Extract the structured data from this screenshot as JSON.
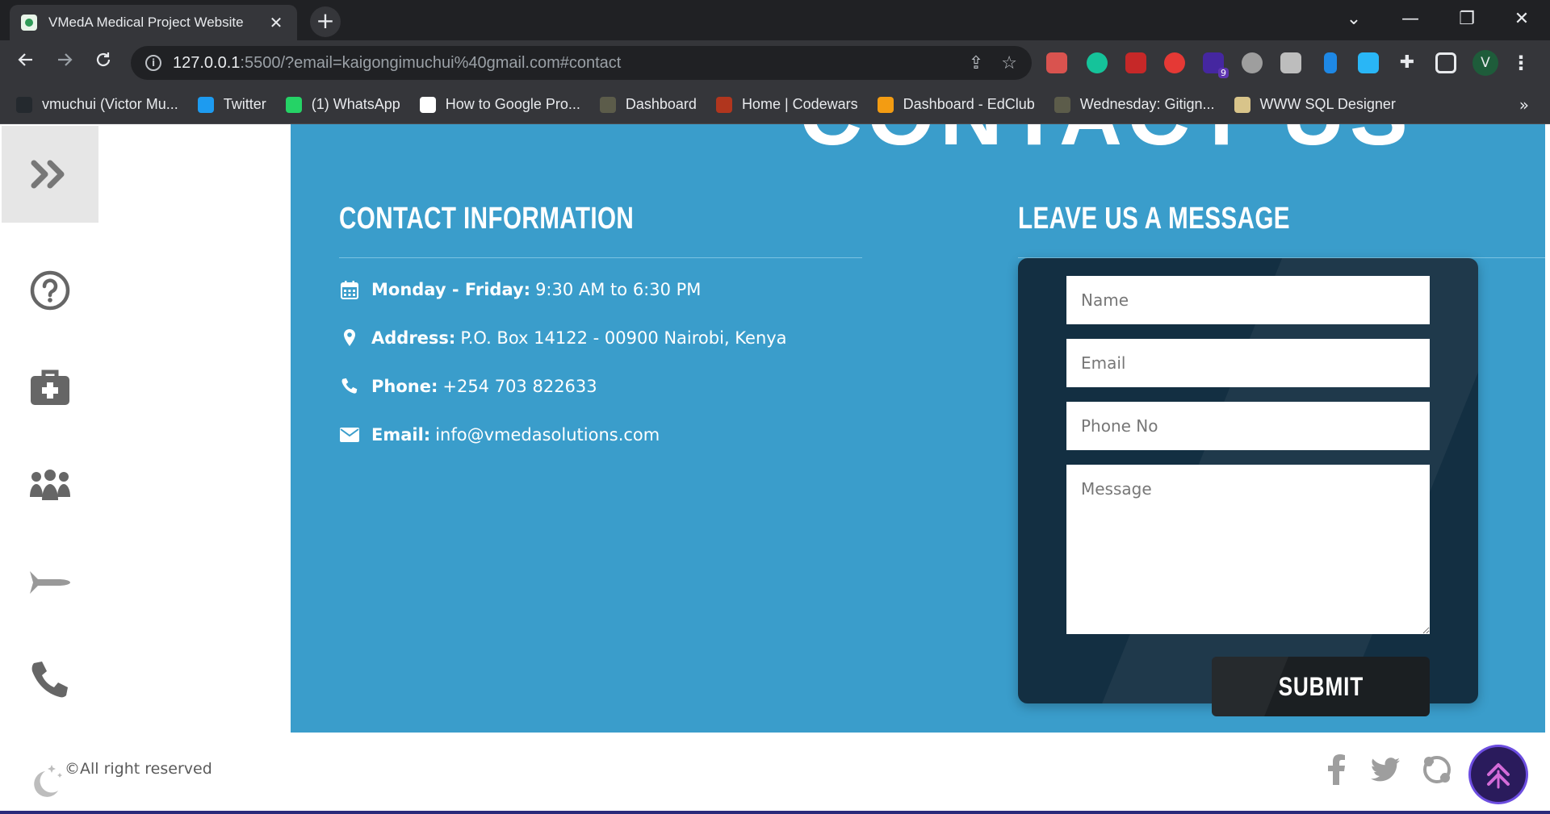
{
  "browser": {
    "tab_title": "VMedA Medical Project Website",
    "tab_close": "✕",
    "new_tab": "+",
    "window_controls": [
      "⌄",
      "—",
      "❐",
      "✕"
    ],
    "url_host": "127.0.0.1",
    "url_rest": ":5500/?email=kaigongimuchui%40gmail.com#contact",
    "profile_initial": "V",
    "bookmarks": [
      {
        "label": "vmuchui (Victor Mu...",
        "icon": "github-icon",
        "color": "#24292e"
      },
      {
        "label": "Twitter",
        "icon": "twitter-icon",
        "color": "#1d9bf0"
      },
      {
        "label": "(1) WhatsApp",
        "icon": "whatsapp-icon",
        "color": "#25d366"
      },
      {
        "label": "How to Google Pro...",
        "icon": "medium-icon",
        "color": "#ffffff"
      },
      {
        "label": "Dashboard",
        "icon": "palm-icon",
        "color": "#5c5c4a"
      },
      {
        "label": "Home | Codewars",
        "icon": "codewars-icon",
        "color": "#b1361e"
      },
      {
        "label": "Dashboard - EdClub",
        "icon": "edclub-icon",
        "color": "#f39c12"
      },
      {
        "label": "Wednesday: Gitign...",
        "icon": "palm-icon",
        "color": "#5c5c4a"
      },
      {
        "label": "WWW SQL Designer",
        "icon": "sql-designer-icon",
        "color": "#d8c48a"
      }
    ],
    "bookmarks_more": "»",
    "extension_badge": "9"
  },
  "page": {
    "contact_heading": "CONTACT US",
    "info_title": "CONTACT INFORMATION",
    "message_title": "LEAVE US A MESSAGE",
    "info": [
      {
        "icon": "calendar-icon",
        "label": "Monday - Friday:",
        "value": "9:30 AM to 6:30 PM"
      },
      {
        "icon": "map-marker-icon",
        "label": "Address:",
        "value": "P.O. Box 14122 - 00900 Nairobi, Kenya"
      },
      {
        "icon": "phone-icon",
        "label": "Phone:",
        "value": "+254 703 822633"
      },
      {
        "icon": "envelope-icon",
        "label": "Email:",
        "value": "info@vmedasolutions.com"
      }
    ],
    "form": {
      "name_placeholder": "Name",
      "email_placeholder": "Email",
      "phone_placeholder": "Phone No",
      "message_placeholder": "Message",
      "submit_label": "SUBMIT"
    },
    "footer": {
      "copyright": "©All right reserved"
    }
  },
  "colors": {
    "contact_bg": "#3a9dcb",
    "form_bg": "#132f42",
    "submit_bg": "#1b1f22",
    "totop_bg": "#2a1b5c",
    "totop_accent": "#d46bd8",
    "sidebar_icon": "#666666"
  }
}
